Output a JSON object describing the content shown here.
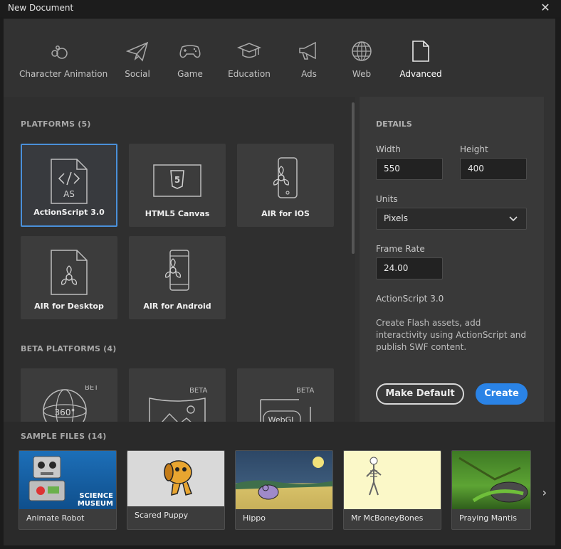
{
  "window": {
    "title": "New Document",
    "close_icon": "close-icon"
  },
  "categories": [
    {
      "label": "Character Animation",
      "icon": "character-animation-icon"
    },
    {
      "label": "Social",
      "icon": "paper-plane-icon"
    },
    {
      "label": "Game",
      "icon": "gamepad-icon"
    },
    {
      "label": "Education",
      "icon": "graduation-cap-icon"
    },
    {
      "label": "Ads",
      "icon": "megaphone-icon"
    },
    {
      "label": "Web",
      "icon": "globe-icon"
    },
    {
      "label": "Advanced",
      "icon": "document-icon",
      "active": true
    }
  ],
  "platforms": {
    "title": "PLATFORMS (5)",
    "items": [
      {
        "label": "ActionScript 3.0",
        "icon": "actionscript-file-icon",
        "selected": true,
        "icon_text": "AS"
      },
      {
        "label": "HTML5 Canvas",
        "icon": "html5-icon",
        "icon_text": "5"
      },
      {
        "label": "AIR for IOS",
        "icon": "ios-phone-icon"
      },
      {
        "label": "AIR for Desktop",
        "icon": "air-desktop-icon"
      },
      {
        "label": "AIR for Android",
        "icon": "android-phone-icon"
      }
    ]
  },
  "beta_platforms": {
    "title": "BETA PLATFORMS (4)",
    "items": [
      {
        "badge": "BETA",
        "icon": "vr-360-icon",
        "icon_text": "360°"
      },
      {
        "badge": "BETA",
        "icon": "vr-panorama-icon"
      },
      {
        "badge": "BETA",
        "icon": "webgl-icon",
        "icon_text": "WebGL"
      }
    ]
  },
  "details": {
    "title": "DETAILS",
    "width_label": "Width",
    "width_value": "550",
    "height_label": "Height",
    "height_value": "400",
    "units_label": "Units",
    "units_value": "Pixels",
    "frame_rate_label": "Frame Rate",
    "frame_rate_value": "24.00",
    "platform_name": "ActionScript 3.0",
    "description": "Create Flash assets, add interactivity using ActionScript and publish SWF content.",
    "make_default_label": "Make Default",
    "create_label": "Create"
  },
  "samples": {
    "title": "SAMPLE FILES (14)",
    "items": [
      {
        "label": "Animate Robot",
        "thumb_text": "SCIENCE MUSEUM"
      },
      {
        "label": "Scared Puppy"
      },
      {
        "label": "Hippo"
      },
      {
        "label": "Mr McBoneyBones"
      },
      {
        "label": "Praying Mantis"
      }
    ],
    "next_icon": "chevron-right-icon"
  }
}
